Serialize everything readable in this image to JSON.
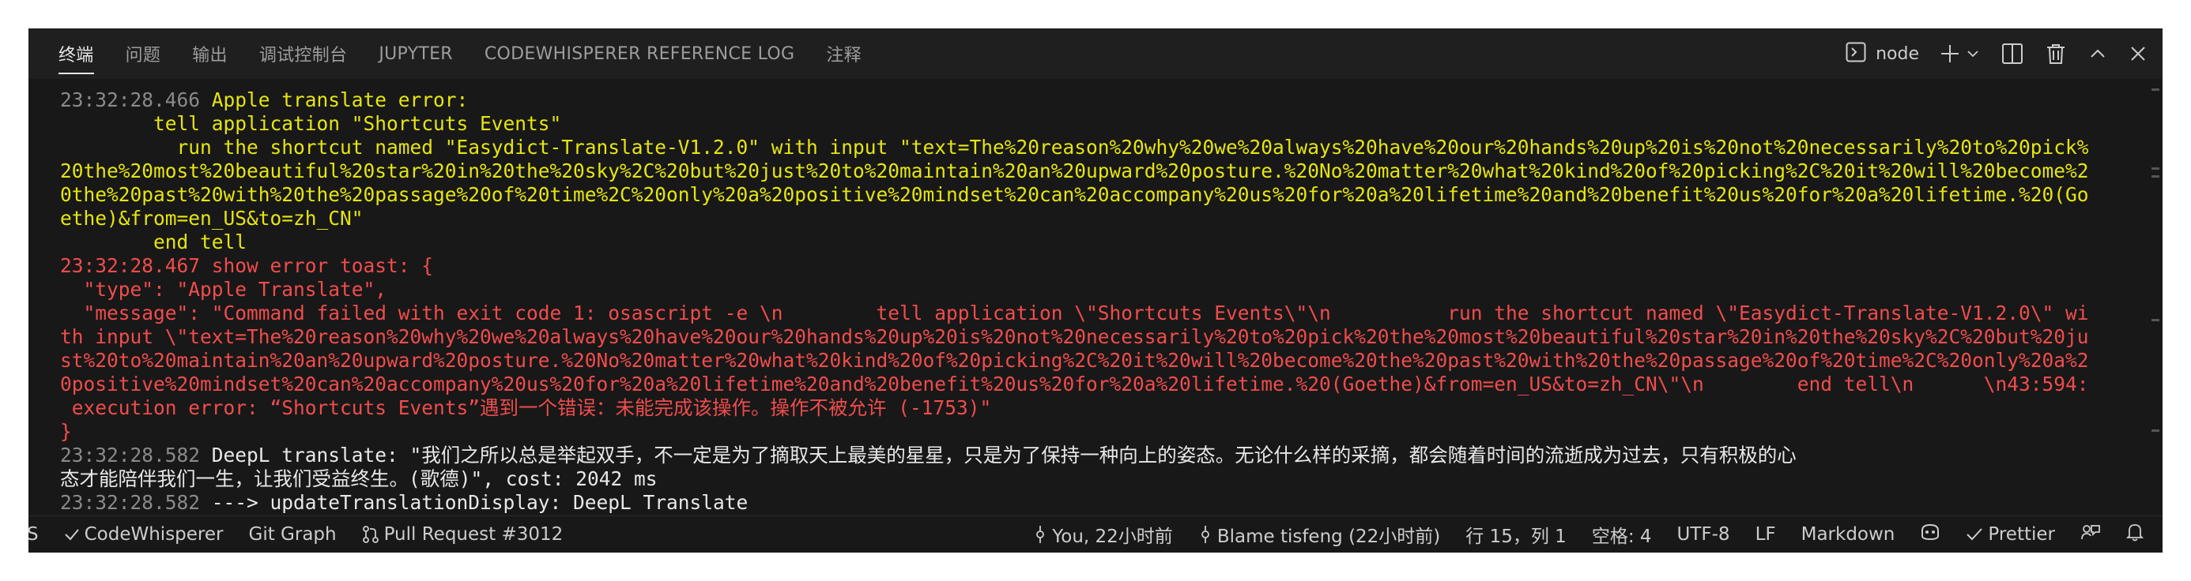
{
  "panel": {
    "tabs": [
      {
        "label": "终端",
        "active": true
      },
      {
        "label": "问题"
      },
      {
        "label": "输出"
      },
      {
        "label": "调试控制台"
      },
      {
        "label": "JUPYTER"
      },
      {
        "label": "CODEWHISPERER REFERENCE LOG"
      },
      {
        "label": "注释"
      }
    ],
    "terminal_profile": "node",
    "toolbar_icons": [
      "terminal-icon",
      "plus-icon",
      "chevron-down-icon",
      "split-icon",
      "trash-icon",
      "chevron-up-icon",
      "close-icon"
    ]
  },
  "terminal": {
    "lines": [
      {
        "ts": "23:32:28.466",
        "text": " Apple translate error:",
        "color": "yellow"
      },
      {
        "ts": "",
        "text": "        tell application \"Shortcuts Events\"",
        "color": "yellow"
      },
      {
        "ts": "",
        "text": "          run the shortcut named \"Easydict-Translate-V1.2.0\" with input \"text=The%20reason%20why%20we%20always%20have%20our%20hands%20up%20is%20not%20necessarily%20to%20pick%",
        "color": "yellow"
      },
      {
        "ts": "",
        "text": "20the%20most%20beautiful%20star%20in%20the%20sky%2C%20but%20just%20to%20maintain%20an%20upward%20posture.%20No%20matter%20what%20kind%20of%20picking%2C%20it%20will%20become%2",
        "color": "yellow"
      },
      {
        "ts": "",
        "text": "0the%20past%20with%20the%20passage%20of%20time%2C%20only%20a%20positive%20mindset%20can%20accompany%20us%20for%20a%20lifetime%20and%20benefit%20us%20for%20a%20lifetime.%20(Go",
        "color": "yellow"
      },
      {
        "ts": "",
        "text": "ethe)&from=en_US&to=zh_CN\"",
        "color": "yellow"
      },
      {
        "ts": "",
        "text": "        end tell",
        "color": "yellow"
      },
      {
        "ts": "",
        "text": "23:32:28.467 show error toast: {",
        "color": "red"
      },
      {
        "ts": "",
        "text": "  \"type\": \"Apple Translate\",",
        "color": "red"
      },
      {
        "ts": "",
        "text": "  \"message\": \"Command failed with exit code 1: osascript -e \\n        tell application \\\"Shortcuts Events\\\"\\n          run the shortcut named \\\"Easydict-Translate-V1.2.0\\\" wi",
        "color": "red"
      },
      {
        "ts": "",
        "text": "th input \\\"text=The%20reason%20why%20we%20always%20have%20our%20hands%20up%20is%20not%20necessarily%20to%20pick%20the%20most%20beautiful%20star%20in%20the%20sky%2C%20but%20ju",
        "color": "red"
      },
      {
        "ts": "",
        "text": "st%20to%20maintain%20an%20upward%20posture.%20No%20matter%20what%20kind%20of%20picking%2C%20it%20will%20become%20the%20past%20with%20the%20passage%20of%20time%2C%20only%20a%2",
        "color": "red"
      },
      {
        "ts": "",
        "text": "0positive%20mindset%20can%20accompany%20us%20for%20a%20lifetime%20and%20benefit%20us%20for%20a%20lifetime.%20(Goethe)&from=en_US&to=zh_CN\\\"\\n        end tell\\n      \\n43:594:",
        "color": "red"
      },
      {
        "ts": "",
        "text": " execution error: “Shortcuts Events”遇到一个错误：未能完成该操作。操作不被允许 (-1753)\"",
        "color": "red"
      },
      {
        "ts": "",
        "text": "}",
        "color": "red"
      },
      {
        "ts": "23:32:28.582",
        "text": " DeepL translate: \"我们之所以总是举起双手，不一定是为了摘取天上最美的星星，只是为了保持一种向上的姿态。无论什么样的采摘，都会随着时间的流逝成为过去，只有积极的心",
        "color": "white"
      },
      {
        "ts": "",
        "text": "态才能陪伴我们一生，让我们受益终生。(歌德)\", cost: 2042 ms",
        "color": "white"
      },
      {
        "ts": "23:32:28.582",
        "text": " ---> updateTranslationDisplay: DeepL Translate",
        "color": "white"
      }
    ]
  },
  "statusbar": {
    "left": [
      {
        "label": "S",
        "icon": ""
      },
      {
        "label": "CodeWhisperer",
        "icon": "check-icon"
      },
      {
        "label": "Git Graph",
        "icon": ""
      },
      {
        "label": "Pull Request #3012",
        "icon": "pull-request-icon"
      }
    ],
    "right": [
      {
        "label": "You, 22小时前",
        "icon": "git-commit-icon"
      },
      {
        "label": "Blame tisfeng (22小时前)",
        "icon": "git-commit-icon"
      },
      {
        "label": "行 15，列 1",
        "icon": ""
      },
      {
        "label": "空格: 4",
        "icon": ""
      },
      {
        "label": "UTF-8",
        "icon": ""
      },
      {
        "label": "LF",
        "icon": ""
      },
      {
        "label": "Markdown",
        "icon": ""
      },
      {
        "label": "",
        "icon": "copilot-icon"
      },
      {
        "label": "Prettier",
        "icon": "check-all-icon"
      },
      {
        "label": "",
        "icon": "feedback-icon"
      },
      {
        "label": "",
        "icon": "bell-icon"
      }
    ]
  },
  "colors": {
    "background": "#181818",
    "tabbar": "#1f1f1f",
    "timestamp": "#8a8a8a",
    "yellow": "#e5e510",
    "red": "#f14c4c",
    "text": "#e8e8e8"
  }
}
